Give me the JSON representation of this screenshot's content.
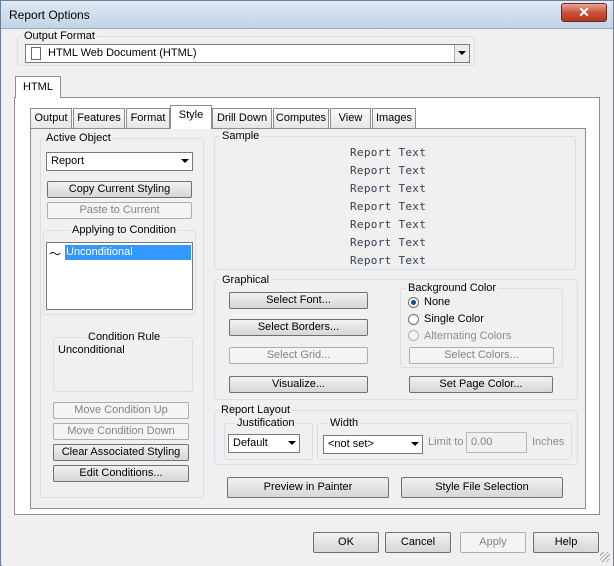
{
  "window": {
    "title": "Report Options",
    "close_glyph": "✕"
  },
  "output_format": {
    "legend": "Output Format",
    "value": "HTML Web Document (HTML)"
  },
  "outer_tab": {
    "label": "HTML"
  },
  "tabs": [
    {
      "label": "Output"
    },
    {
      "label": "Features"
    },
    {
      "label": "Format"
    },
    {
      "label": "Style"
    },
    {
      "label": "Drill Down"
    },
    {
      "label": "Computes"
    },
    {
      "label": "View"
    },
    {
      "label": "Images"
    }
  ],
  "active_object": {
    "legend": "Active Object",
    "value": "Report",
    "copy_label": "Copy Current Styling",
    "paste_label": "Paste to Current"
  },
  "applying": {
    "legend": "Applying to Condition",
    "selected_item": "Unconditional",
    "item_glyph": "〜"
  },
  "condition_rule": {
    "legend": "Condition Rule",
    "value": "Unconditional"
  },
  "condition_buttons": {
    "up": "Move Condition Up",
    "down": "Move Condition Down",
    "clear": "Clear Associated Styling",
    "edit": "Edit Conditions..."
  },
  "sample": {
    "legend": "Sample",
    "lines": [
      "Report Text",
      "Report Text",
      "Report Text",
      "Report Text",
      "Report Text",
      "Report Text",
      "Report Text"
    ]
  },
  "graphical": {
    "legend": "Graphical",
    "select_font": "Select Font...",
    "select_borders": "Select Borders...",
    "select_grid": "Select Grid...",
    "visualize": "Visualize..."
  },
  "background": {
    "legend": "Background Color",
    "none": "None",
    "single": "Single Color",
    "alternating": "Alternating Colors",
    "select_colors": "Select Colors...",
    "set_page_color": "Set Page Color...",
    "selected": "None"
  },
  "report_layout": {
    "legend": "Report Layout",
    "justification_legend": "Justification",
    "justification_value": "Default",
    "width_legend": "Width",
    "width_value": "<not set>",
    "limit_label": "Limit to",
    "limit_value": "0.00",
    "units": "Inches"
  },
  "bottom_buttons": {
    "preview": "Preview in Painter",
    "style_file": "Style File Selection"
  },
  "dialog_buttons": {
    "ok": "OK",
    "cancel": "Cancel",
    "apply": "Apply",
    "help": "Help"
  },
  "colors": {
    "selection": "#3399ff",
    "title_bar": "#c3d3e6",
    "sample_text": "#333f4f"
  }
}
